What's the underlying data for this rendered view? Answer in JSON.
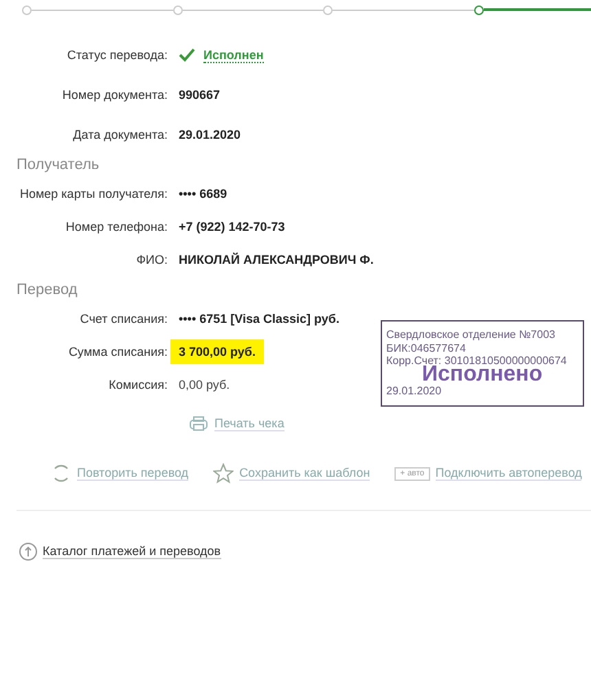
{
  "steps": [
    {
      "selected": false
    },
    {
      "selected": false
    },
    {
      "selected": false
    },
    {
      "selected": true
    }
  ],
  "details": [
    {
      "kind": "status",
      "label": "Статус перевода:",
      "value": "Исполнен"
    },
    {
      "kind": "bold",
      "label": "Номер документа:",
      "value": "990667"
    },
    {
      "kind": "bold",
      "label": "Дата документа:",
      "value": "29.01.2020"
    }
  ],
  "sections": [
    {
      "title": "Получатель",
      "rows": [
        {
          "kind": "bold",
          "label": "Номер карты получателя:",
          "value": "•••• 6689"
        },
        {
          "kind": "bold",
          "label": "Номер телефона:",
          "value": "+7 (922) 142-70-73"
        },
        {
          "kind": "bold",
          "label": "ФИО:",
          "value": "НИКОЛАЙ АЛЕКСАНДРОВИЧ Ф."
        }
      ]
    },
    {
      "title": "Перевод",
      "rows": [
        {
          "kind": "bold",
          "label": "Счет списания:",
          "value": "•••• 6751  [Visa Classic]  руб."
        },
        {
          "kind": "highlight",
          "label": "Сумма списания:",
          "value": "3 700,00  руб."
        },
        {
          "kind": "plain",
          "label": "Комиссия:",
          "value": "0,00 руб."
        }
      ]
    }
  ],
  "stamp": {
    "lines": [
      "Свердловское отделение №7003",
      "БИК:046577674",
      "Корр.Счет: 30101810500000000674"
    ],
    "status": "Исполнено",
    "date": "29.01.2020"
  },
  "print_link": "Печать чека",
  "actions": [
    {
      "kind": "repeat",
      "label": "Повторить перевод"
    },
    {
      "kind": "star",
      "label": "Сохранить как шаблон"
    },
    {
      "kind": "auto",
      "badge": "+ авто",
      "label": "Подключить автоперевод"
    }
  ],
  "catalog_link": "Каталог платежей и переводов"
}
